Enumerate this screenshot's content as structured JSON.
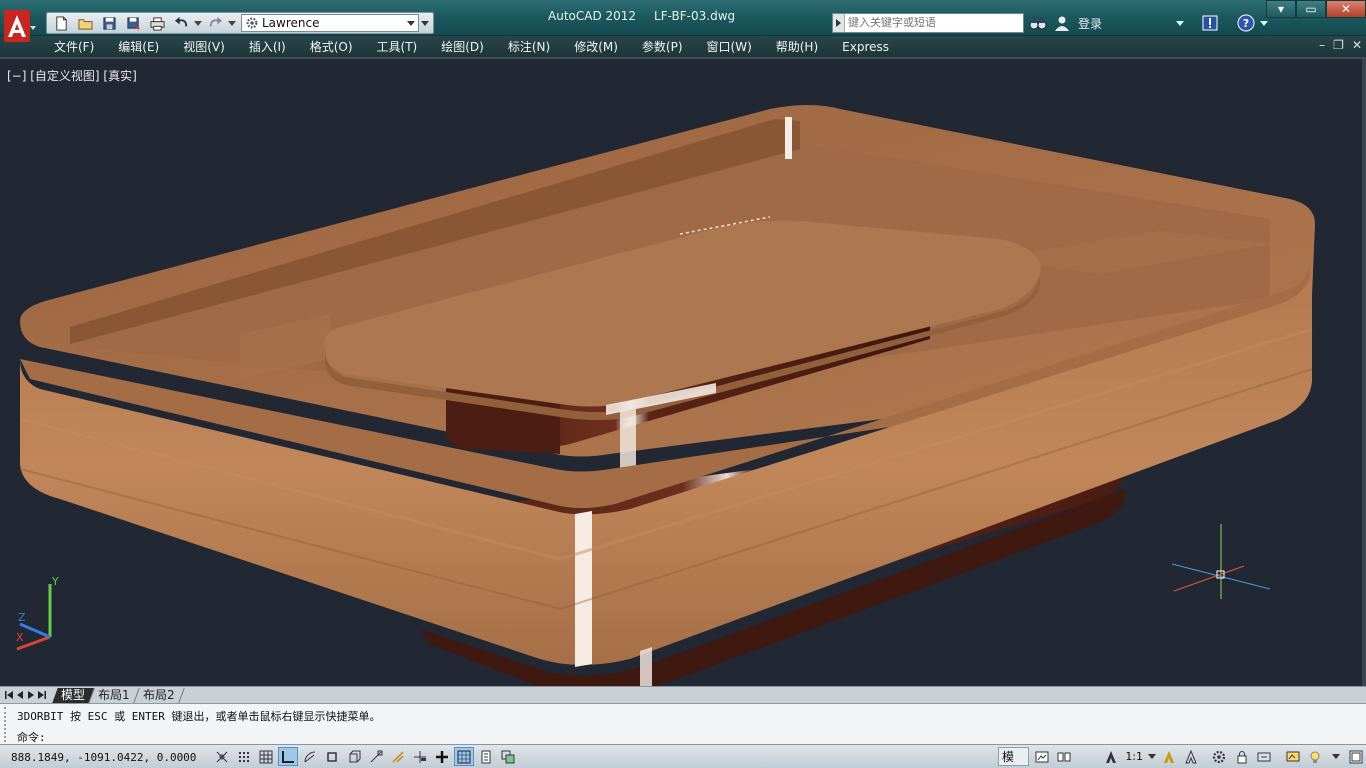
{
  "window": {
    "app_name": "AutoCAD 2012",
    "file_name": "LF-BF-03.dwg",
    "controls": {
      "minimize": "▾",
      "restore": "▭",
      "close": "✕"
    }
  },
  "quick_access": {
    "workspace": "Lawrence",
    "icons": [
      "new-icon",
      "open-icon",
      "save-icon",
      "save-as-icon",
      "plot-icon",
      "undo-icon",
      "redo-icon"
    ]
  },
  "infocenter": {
    "search_placeholder": "键入关键字或短语",
    "login_label": "登录"
  },
  "menu": {
    "items": [
      "文件(F)",
      "编辑(E)",
      "视图(V)",
      "插入(I)",
      "格式(O)",
      "工具(T)",
      "绘图(D)",
      "标注(N)",
      "修改(M)",
      "参数(P)",
      "窗口(W)",
      "帮助(H)",
      "Express"
    ]
  },
  "viewport": {
    "label": "[−] [自定义视图] [真实]",
    "axis_labels": {
      "x": "X",
      "y": "Y",
      "z": "Z"
    }
  },
  "layout_tabs": [
    "模型",
    "布局1",
    "布局2"
  ],
  "command": {
    "history": "3DORBIT 按 ESC 或 ENTER 键退出，或者单击鼠标右键显示快捷菜单。",
    "prompt": "命令:"
  },
  "status": {
    "coordinates": "888.1849,  -1091.0422, 0.0000",
    "model_label": "模型",
    "annotation_scale": "1:1"
  },
  "colors": {
    "viewport_bg": "#212733",
    "wood_light": "#b07a52",
    "wood_dark": "#5a2a1c",
    "title_bar": "#1c5a5f"
  }
}
